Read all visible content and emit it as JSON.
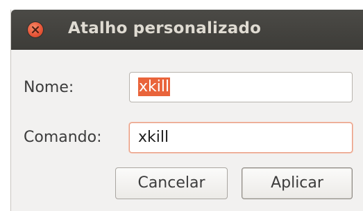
{
  "window": {
    "title": "Atalho personalizado",
    "close_icon": "close-icon"
  },
  "form": {
    "name_label": "Nome:",
    "name_value": "xkill",
    "name_selected": true,
    "command_label": "Comando:",
    "command_value": "xkill"
  },
  "buttons": {
    "cancel_label": "Cancelar",
    "apply_label": "Aplicar"
  },
  "colors": {
    "titlebar": "#3f3e3a",
    "close_button": "#e9573a",
    "selection": "#e9643b",
    "focus_border": "#e89a80",
    "dialog_background": "#f2f1f0"
  }
}
